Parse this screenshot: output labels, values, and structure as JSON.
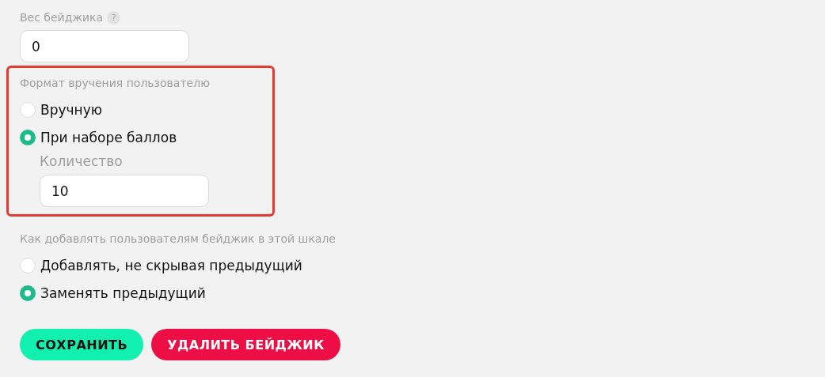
{
  "weight": {
    "label": "Вес бейджика",
    "help": "?",
    "value": "0"
  },
  "award_format": {
    "highlighted": true,
    "label": "Формат вручения пользователю",
    "options": [
      {
        "label": "Вручную",
        "selected": false
      },
      {
        "label": "При наборе баллов",
        "selected": true,
        "field": {
          "label": "Количество",
          "value": "10"
        }
      }
    ]
  },
  "add_mode": {
    "label": "Как добавлять пользователям бейджик в этой шкале",
    "options": [
      {
        "label": "Добавлять, не скрывая предыдущий",
        "selected": false
      },
      {
        "label": "Заменять предыдущий",
        "selected": true
      }
    ]
  },
  "buttons": [
    {
      "label": "СОХРАНИТЬ",
      "kind": "primary"
    },
    {
      "label": "УДАЛИТЬ БЕЙДЖИК",
      "kind": "danger"
    }
  ]
}
